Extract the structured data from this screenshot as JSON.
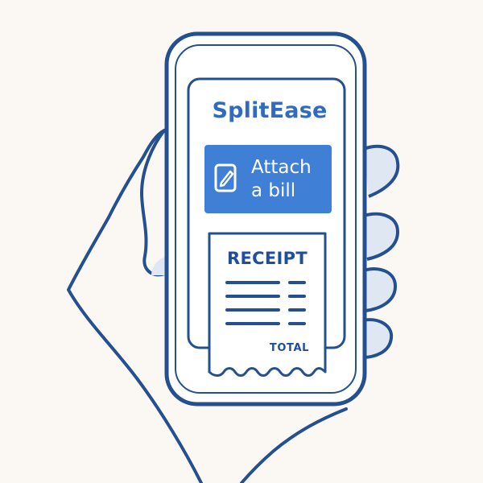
{
  "app": {
    "title": "SplitEase"
  },
  "attach_button": {
    "label": "Attach\na bill",
    "icon": "document-edit-icon"
  },
  "receipt": {
    "title": "RECEIPT",
    "total_label": "TOTAL",
    "line_items": 4
  },
  "colors": {
    "outline": "#24508f",
    "accent": "#3f7fd6",
    "title_text": "#2f6cc0",
    "background": "#fbf8f3",
    "hand_shadow": "#dfe7f3"
  }
}
